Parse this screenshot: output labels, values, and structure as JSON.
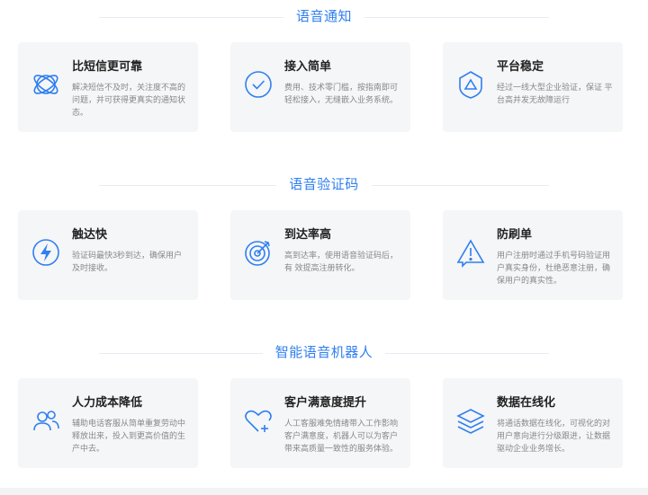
{
  "sections": [
    {
      "title": "语音通知",
      "cards": [
        {
          "title": "比短信更可靠",
          "desc": "解决短信不及时，关注度不高的问题，并可获得更真实的通知状态。",
          "icon": "orbit-icon"
        },
        {
          "title": "接入简单",
          "desc": "费用、技术零门槛，按指南即可 轻松接入，无缝嵌入业务系统。",
          "icon": "check-circle-icon"
        },
        {
          "title": "平台稳定",
          "desc": "经过一线大型企业验证，保证 平台高并发无故障运行",
          "icon": "shield-icon"
        }
      ]
    },
    {
      "title": "语音验证码",
      "cards": [
        {
          "title": "触达快",
          "desc": "验证码最快3秒到达，确保用户及时接收。",
          "icon": "lightning-icon"
        },
        {
          "title": "到达率高",
          "desc": "高到达率，使用语音验证码后，有 效提高注册转化。",
          "icon": "target-icon"
        },
        {
          "title": "防刷单",
          "desc": "用户注册时通过手机号码验证用 户真实身份，杜绝恶意注册，确 保用户的真实性。",
          "icon": "warning-icon"
        }
      ]
    },
    {
      "title": "智能语音机器人",
      "cards": [
        {
          "title": "人力成本降低",
          "desc": "辅助电话客服从简单重复劳动中 释放出来，投入到更高价值的生 产中去。",
          "icon": "users-icon"
        },
        {
          "title": "客户满意度提升",
          "desc": "人工客服难免情绪带入工作影响 客户满意度，机器人可以为客户 带来高质量一致性的服务体验。",
          "icon": "heart-plus-icon"
        },
        {
          "title": "数据在线化",
          "desc": "将通话数据在线化，可视化的对 用户意向进行分级跟进，让数据 驱动企业业务增长。",
          "icon": "layers-icon"
        }
      ]
    }
  ],
  "colors": {
    "accent": "#2f7ff0",
    "card_bg": "#f5f6f8",
    "title": "#222222",
    "desc": "#888888"
  }
}
